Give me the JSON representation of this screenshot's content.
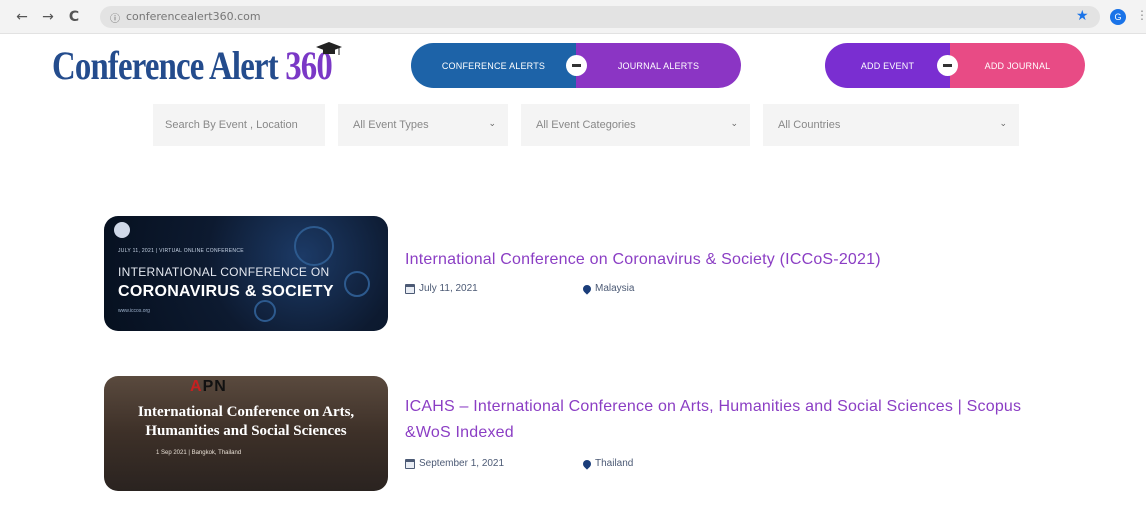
{
  "browser": {
    "url": "conferencealert360.com",
    "back_glyph": "←",
    "forward_glyph": "→",
    "reload_glyph": "C",
    "lock_glyph": "ⓘ",
    "star_glyph": "★",
    "profile_initial": "G",
    "menu_glyph": "⋮"
  },
  "header": {
    "logo_text": "Conference Alert",
    "logo_number": "360",
    "toggle_alerts": {
      "left_label": "CONFERENCE ALERTS",
      "right_label": "JOURNAL ALERTS"
    },
    "toggle_add": {
      "left_label": "ADD EVENT",
      "right_label": "ADD JOURNAL"
    }
  },
  "filters": {
    "search_placeholder": "Search By Event , Location",
    "event_type": "All Event Types",
    "event_category": "All Event Categories",
    "country": "All Countries",
    "chevron_glyph": "⌄"
  },
  "events": [
    {
      "title": "International Conference on Coronavirus & Society (ICCoS-2021)",
      "date": "July 11, 2021",
      "location": "Malaysia",
      "banner": {
        "small": "JULY 11, 2021 | VIRTUAL ONLINE CONFERENCE",
        "line1": "INTERNATIONAL CONFERENCE ON",
        "line2": "CORONAVIRUS & SOCIETY",
        "url": "www.iccos.org"
      }
    },
    {
      "title": "ICAHS – International Conference on Arts, Humanities and Social Sciences | Scopus &WoS Indexed",
      "date": "September 1, 2021",
      "location": "Thailand",
      "banner": {
        "logo_a": "A",
        "logo_rest": "PN",
        "line1": "International Conference on Arts,",
        "line2": "Humanities and Social Sciences",
        "date_line": "1 Sep 2021 | Bangkok, Thailand"
      }
    }
  ],
  "colors": {
    "brand_blue": "#244c8d",
    "brand_purple": "#8b3ec4",
    "pill_blue": "#1d63a8",
    "pill_pink": "#e84b85"
  }
}
